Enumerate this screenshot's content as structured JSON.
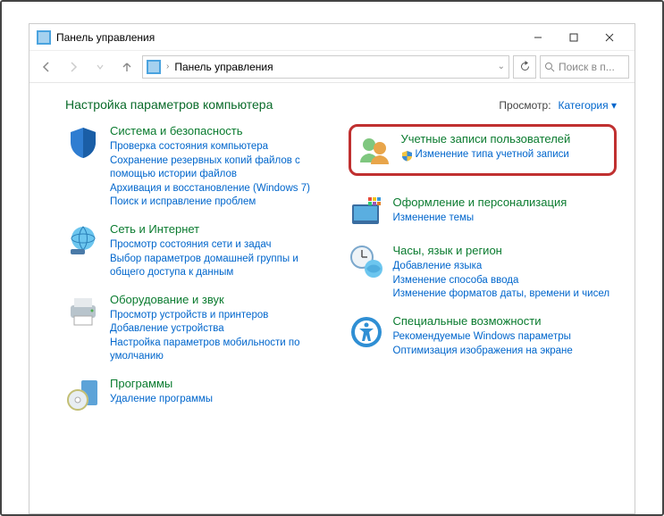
{
  "window": {
    "title": "Панель управления"
  },
  "nav": {
    "breadcrumb": "Панель управления",
    "search_placeholder": "Поиск в п..."
  },
  "header": {
    "page_title": "Настройка параметров компьютера",
    "view_label": "Просмотр:",
    "view_value": "Категория"
  },
  "left_col": [
    {
      "id": "system-security",
      "title": "Система и безопасность",
      "links": [
        "Проверка состояния компьютера",
        "Сохранение резервных копий файлов с помощью истории файлов",
        "Архивация и восстановление (Windows 7)",
        "Поиск и исправление проблем"
      ]
    },
    {
      "id": "network-internet",
      "title": "Сеть и Интернет",
      "links": [
        "Просмотр состояния сети и задач",
        "Выбор параметров домашней группы и общего доступа к данным"
      ]
    },
    {
      "id": "hardware-sound",
      "title": "Оборудование и звук",
      "links": [
        "Просмотр устройств и принтеров",
        "Добавление устройства",
        "Настройка параметров мобильности по умолчанию"
      ]
    },
    {
      "id": "programs",
      "title": "Программы",
      "links": [
        "Удаление программы"
      ]
    }
  ],
  "right_col": [
    {
      "id": "user-accounts",
      "highlight": true,
      "title": "Учетные записи пользователей",
      "shield_links": [
        "Изменение типа учетной записи"
      ]
    },
    {
      "id": "appearance",
      "title": "Оформление и персонализация",
      "links": [
        "Изменение темы"
      ]
    },
    {
      "id": "clock-language",
      "title": "Часы, язык и регион",
      "links": [
        "Добавление языка",
        "Изменение способа ввода",
        "Изменение форматов даты, времени и чисел"
      ]
    },
    {
      "id": "accessibility",
      "title": "Специальные возможности",
      "links": [
        "Рекомендуемые Windows параметры",
        "Оптимизация изображения на экране"
      ]
    }
  ]
}
